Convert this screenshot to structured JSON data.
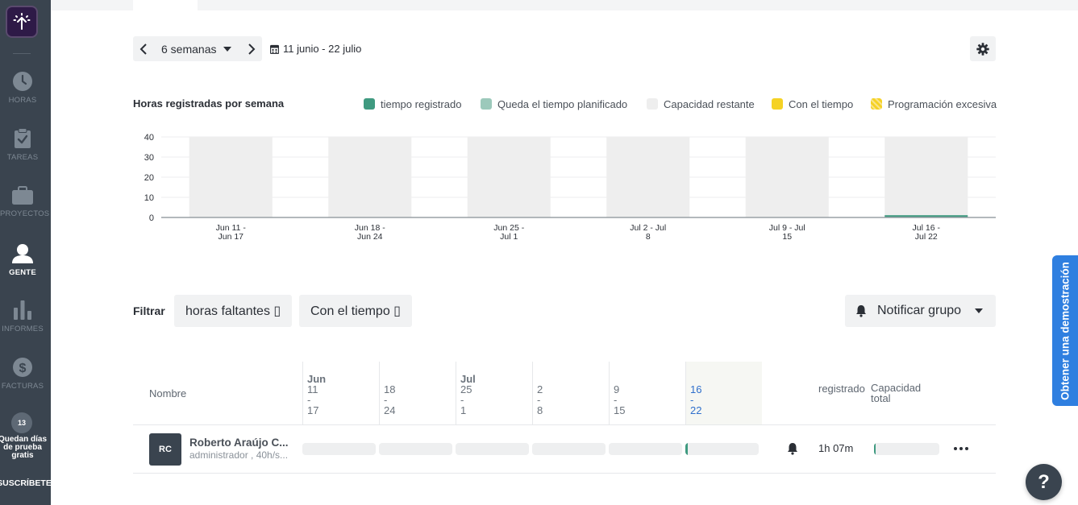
{
  "sidebar": {
    "items": [
      {
        "label": "HORAS",
        "icon": "clock-icon"
      },
      {
        "label": "TAREAS",
        "icon": "clipboard-check-icon"
      },
      {
        "label": "PROYECTOS",
        "icon": "briefcase-icon"
      },
      {
        "label": "GENTE",
        "icon": "person-icon"
      },
      {
        "label": "INFORMES",
        "icon": "bar-chart-icon"
      },
      {
        "label": "FACTURAS",
        "icon": "dollar-icon"
      }
    ],
    "active": "GENTE",
    "trial_days": "13",
    "trial_text": "Quedan días de prueba gratis",
    "subscribe": "SUSCRÍBETE"
  },
  "toolbar": {
    "period_label": "6 semanas",
    "date_range": "11 junio - 22 julio"
  },
  "chart": {
    "title": "Horas registradas por semana",
    "legend": [
      {
        "label": "tiempo registrado",
        "color": "#3f9a80"
      },
      {
        "label": "Queda el tiempo planificado",
        "color": "#9cc9bb"
      },
      {
        "label": "Capacidad restante",
        "color": "#eeeeee"
      },
      {
        "label": "Con el tiempo",
        "color": "#f5d224"
      },
      {
        "label": "Programación excesiva",
        "color": "#f7d65e"
      }
    ]
  },
  "chart_data": {
    "type": "bar",
    "title": "Horas registradas por semana",
    "categories": [
      [
        "Jun 11 -",
        "Jun 17"
      ],
      [
        "Jun 18 -",
        "Jun 24"
      ],
      [
        "Jun 25 -",
        "Jul 1"
      ],
      [
        "Jul 2 - Jul",
        "8"
      ],
      [
        "Jul 9 - Jul",
        "15"
      ],
      [
        "Jul 16 -",
        "Jul 22"
      ]
    ],
    "series": [
      {
        "name": "tiempo registrado",
        "color": "#3f9a80",
        "values": [
          0,
          0,
          0,
          0,
          0,
          1.12
        ]
      },
      {
        "name": "Capacidad restante",
        "color": "#eeeeee",
        "values": [
          40,
          40,
          40,
          40,
          40,
          38.88
        ]
      }
    ],
    "yticks": [
      0,
      10,
      20,
      30,
      40
    ],
    "ylim": [
      0,
      40
    ],
    "legend_position": "top-right"
  },
  "filters": {
    "label": "Filtrar",
    "buttons": [
      "horas faltantes ▯",
      "Con el tiempo ▯"
    ],
    "notify_label": "Notificar grupo"
  },
  "table": {
    "name_header": "Nombre",
    "weeks": [
      {
        "month": "Jun",
        "start": "11",
        "dash": "-",
        "end": "17"
      },
      {
        "month": "",
        "start": "18",
        "dash": "-",
        "end": "24"
      },
      {
        "month": "Jul",
        "start": "25",
        "dash": "-",
        "end": "1"
      },
      {
        "month": "",
        "start": "2",
        "dash": "-",
        "end": "8"
      },
      {
        "month": "",
        "start": "9",
        "dash": "-",
        "end": "15"
      },
      {
        "month": "",
        "start": "16",
        "dash": "-",
        "end": "22"
      }
    ],
    "registered_header": "registrado",
    "capacity_header": "Capacidad total",
    "rows": [
      {
        "initials": "RC",
        "name": "Roberto Araújo C...",
        "role": "administrador , 40h/s...",
        "week_progress": [
          0,
          0,
          0,
          0,
          0,
          0.028
        ],
        "registered": "1h 07m",
        "capacity_progress": 0.028
      }
    ]
  },
  "demo_tab": "Obtener una demostración",
  "help": "?"
}
